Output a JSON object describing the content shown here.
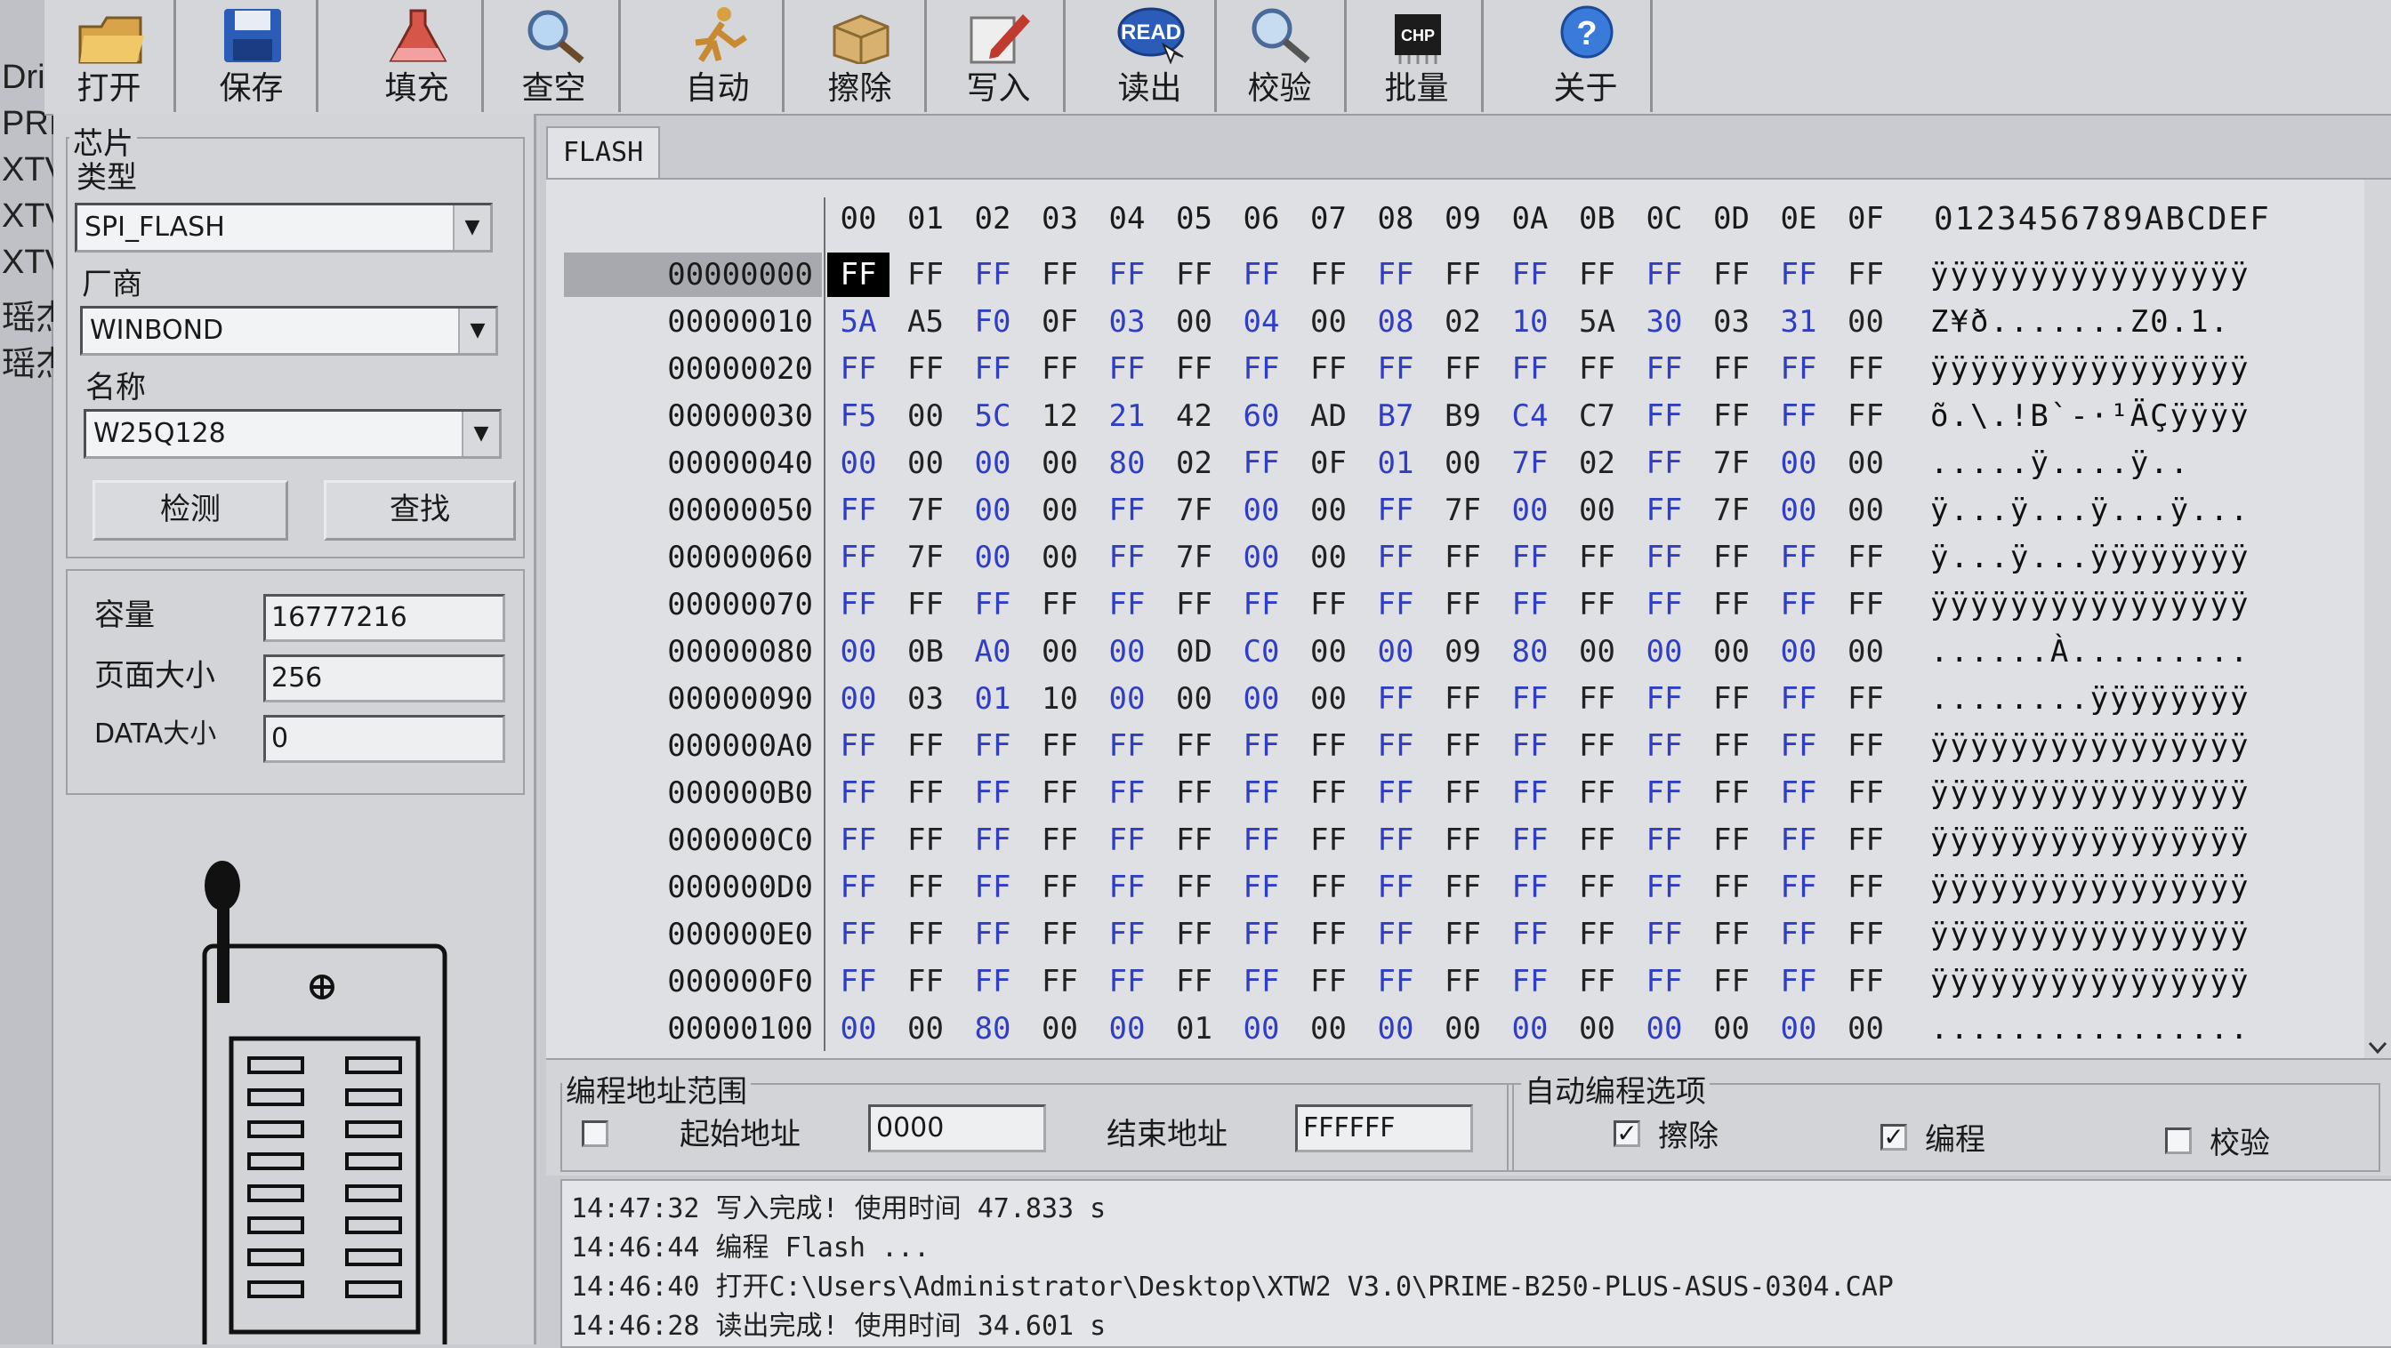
{
  "left_strip": [
    "Dri",
    "PRI",
    "XTV",
    "XTV",
    "XTV",
    "瑶杰",
    "瑶杰"
  ],
  "toolbar": [
    {
      "label": "打开",
      "icon": "open-folder-icon"
    },
    {
      "label": "保存",
      "icon": "save-disk-icon"
    },
    {
      "label": "填充",
      "icon": "fill-flask-icon"
    },
    {
      "label": "查空",
      "icon": "blank-check-magnifier-icon"
    },
    {
      "label": "自动",
      "icon": "auto-runner-icon"
    },
    {
      "label": "擦除",
      "icon": "erase-box-icon"
    },
    {
      "label": "写入",
      "icon": "write-pen-icon"
    },
    {
      "label": "读出",
      "icon": "read-icon",
      "icon_text": "READ"
    },
    {
      "label": "校验",
      "icon": "verify-magnifier-icon"
    },
    {
      "label": "批量",
      "icon": "batch-chip-icon",
      "icon_text": "CHP"
    },
    {
      "label": "关于",
      "icon": "about-help-icon"
    }
  ],
  "chip": {
    "group_label": "芯片",
    "type_label": "类型",
    "type_value": "SPI_FLASH",
    "vendor_label": "厂商",
    "vendor_value": "WINBOND",
    "name_label": "名称",
    "name_value": "W25Q128",
    "detect_button": "检测",
    "search_button": "查找",
    "capacity_label": "容量",
    "capacity_value": "16777216",
    "page_size_label": "页面大小",
    "page_size_value": "256",
    "data_size_label": "DATA大小",
    "data_size_value": "0"
  },
  "hex": {
    "tab": "FLASH",
    "columns": [
      "00",
      "01",
      "02",
      "03",
      "04",
      "05",
      "06",
      "07",
      "08",
      "09",
      "0A",
      "0B",
      "0C",
      "0D",
      "0E",
      "0F"
    ],
    "ascii_header": "0123456789ABCDEF",
    "rows": [
      {
        "addr": "00000000",
        "bytes": [
          "FF",
          "FF",
          "FF",
          "FF",
          "FF",
          "FF",
          "FF",
          "FF",
          "FF",
          "FF",
          "FF",
          "FF",
          "FF",
          "FF",
          "FF",
          "FF"
        ],
        "ascii": "ÿÿÿÿÿÿÿÿÿÿÿÿÿÿÿÿ"
      },
      {
        "addr": "00000010",
        "bytes": [
          "5A",
          "A5",
          "F0",
          "0F",
          "03",
          "00",
          "04",
          "00",
          "08",
          "02",
          "10",
          "5A",
          "30",
          "03",
          "31",
          "00"
        ],
        "ascii": "Z¥ð.......Z0.1."
      },
      {
        "addr": "00000020",
        "bytes": [
          "FF",
          "FF",
          "FF",
          "FF",
          "FF",
          "FF",
          "FF",
          "FF",
          "FF",
          "FF",
          "FF",
          "FF",
          "FF",
          "FF",
          "FF",
          "FF"
        ],
        "ascii": "ÿÿÿÿÿÿÿÿÿÿÿÿÿÿÿÿ"
      },
      {
        "addr": "00000030",
        "bytes": [
          "F5",
          "00",
          "5C",
          "12",
          "21",
          "42",
          "60",
          "AD",
          "B7",
          "B9",
          "C4",
          "C7",
          "FF",
          "FF",
          "FF",
          "FF"
        ],
        "ascii": "õ.\\.!B`-·¹ÄÇÿÿÿÿ"
      },
      {
        "addr": "00000040",
        "bytes": [
          "00",
          "00",
          "00",
          "00",
          "80",
          "02",
          "FF",
          "0F",
          "01",
          "00",
          "7F",
          "02",
          "FF",
          "7F",
          "00",
          "00"
        ],
        "ascii": ".....ÿ....ÿ.."
      },
      {
        "addr": "00000050",
        "bytes": [
          "FF",
          "7F",
          "00",
          "00",
          "FF",
          "7F",
          "00",
          "00",
          "FF",
          "7F",
          "00",
          "00",
          "FF",
          "7F",
          "00",
          "00"
        ],
        "ascii": "ÿ...ÿ...ÿ...ÿ..."
      },
      {
        "addr": "00000060",
        "bytes": [
          "FF",
          "7F",
          "00",
          "00",
          "FF",
          "7F",
          "00",
          "00",
          "FF",
          "FF",
          "FF",
          "FF",
          "FF",
          "FF",
          "FF",
          "FF"
        ],
        "ascii": "ÿ...ÿ...ÿÿÿÿÿÿÿÿ"
      },
      {
        "addr": "00000070",
        "bytes": [
          "FF",
          "FF",
          "FF",
          "FF",
          "FF",
          "FF",
          "FF",
          "FF",
          "FF",
          "FF",
          "FF",
          "FF",
          "FF",
          "FF",
          "FF",
          "FF"
        ],
        "ascii": "ÿÿÿÿÿÿÿÿÿÿÿÿÿÿÿÿ"
      },
      {
        "addr": "00000080",
        "bytes": [
          "00",
          "0B",
          "A0",
          "00",
          "00",
          "0D",
          "C0",
          "00",
          "00",
          "09",
          "80",
          "00",
          "00",
          "00",
          "00",
          "00"
        ],
        "ascii": "......À........."
      },
      {
        "addr": "00000090",
        "bytes": [
          "00",
          "03",
          "01",
          "10",
          "00",
          "00",
          "00",
          "00",
          "FF",
          "FF",
          "FF",
          "FF",
          "FF",
          "FF",
          "FF",
          "FF"
        ],
        "ascii": "........ÿÿÿÿÿÿÿÿ"
      },
      {
        "addr": "000000A0",
        "bytes": [
          "FF",
          "FF",
          "FF",
          "FF",
          "FF",
          "FF",
          "FF",
          "FF",
          "FF",
          "FF",
          "FF",
          "FF",
          "FF",
          "FF",
          "FF",
          "FF"
        ],
        "ascii": "ÿÿÿÿÿÿÿÿÿÿÿÿÿÿÿÿ"
      },
      {
        "addr": "000000B0",
        "bytes": [
          "FF",
          "FF",
          "FF",
          "FF",
          "FF",
          "FF",
          "FF",
          "FF",
          "FF",
          "FF",
          "FF",
          "FF",
          "FF",
          "FF",
          "FF",
          "FF"
        ],
        "ascii": "ÿÿÿÿÿÿÿÿÿÿÿÿÿÿÿÿ"
      },
      {
        "addr": "000000C0",
        "bytes": [
          "FF",
          "FF",
          "FF",
          "FF",
          "FF",
          "FF",
          "FF",
          "FF",
          "FF",
          "FF",
          "FF",
          "FF",
          "FF",
          "FF",
          "FF",
          "FF"
        ],
        "ascii": "ÿÿÿÿÿÿÿÿÿÿÿÿÿÿÿÿ"
      },
      {
        "addr": "000000D0",
        "bytes": [
          "FF",
          "FF",
          "FF",
          "FF",
          "FF",
          "FF",
          "FF",
          "FF",
          "FF",
          "FF",
          "FF",
          "FF",
          "FF",
          "FF",
          "FF",
          "FF"
        ],
        "ascii": "ÿÿÿÿÿÿÿÿÿÿÿÿÿÿÿÿ"
      },
      {
        "addr": "000000E0",
        "bytes": [
          "FF",
          "FF",
          "FF",
          "FF",
          "FF",
          "FF",
          "FF",
          "FF",
          "FF",
          "FF",
          "FF",
          "FF",
          "FF",
          "FF",
          "FF",
          "FF"
        ],
        "ascii": "ÿÿÿÿÿÿÿÿÿÿÿÿÿÿÿÿ"
      },
      {
        "addr": "000000F0",
        "bytes": [
          "FF",
          "FF",
          "FF",
          "FF",
          "FF",
          "FF",
          "FF",
          "FF",
          "FF",
          "FF",
          "FF",
          "FF",
          "FF",
          "FF",
          "FF",
          "FF"
        ],
        "ascii": "ÿÿÿÿÿÿÿÿÿÿÿÿÿÿÿÿ"
      },
      {
        "addr": "00000100",
        "bytes": [
          "00",
          "00",
          "80",
          "00",
          "00",
          "01",
          "00",
          "00",
          "00",
          "00",
          "00",
          "00",
          "00",
          "00",
          "00",
          "00"
        ],
        "ascii": "................"
      }
    ]
  },
  "range": {
    "group_label": "编程地址范围",
    "start_label": "起始地址",
    "start_value": "0000",
    "end_label": "结束地址",
    "end_value": "FFFFFF"
  },
  "auto_options": {
    "group_label": "自动编程选项",
    "erase_label": "擦除",
    "erase_checked": true,
    "program_label": "编程",
    "program_checked": true,
    "verify_label": "校验",
    "verify_checked": false
  },
  "log": [
    "14:47:32 写入完成! 使用时间 47.833 s",
    "14:46:44 编程 Flash ...",
    "14:46:40 打开C:\\Users\\Administrator\\Desktop\\XTW2 V3.0\\PRIME-B250-PLUS-ASUS-0304.CAP",
    "14:46:28 读出完成! 使用时间 34.601 s"
  ],
  "colors": {
    "hex_blue": "#2f3ec4",
    "hex_dark": "#222222",
    "selected_row": "#a7a9ae"
  }
}
